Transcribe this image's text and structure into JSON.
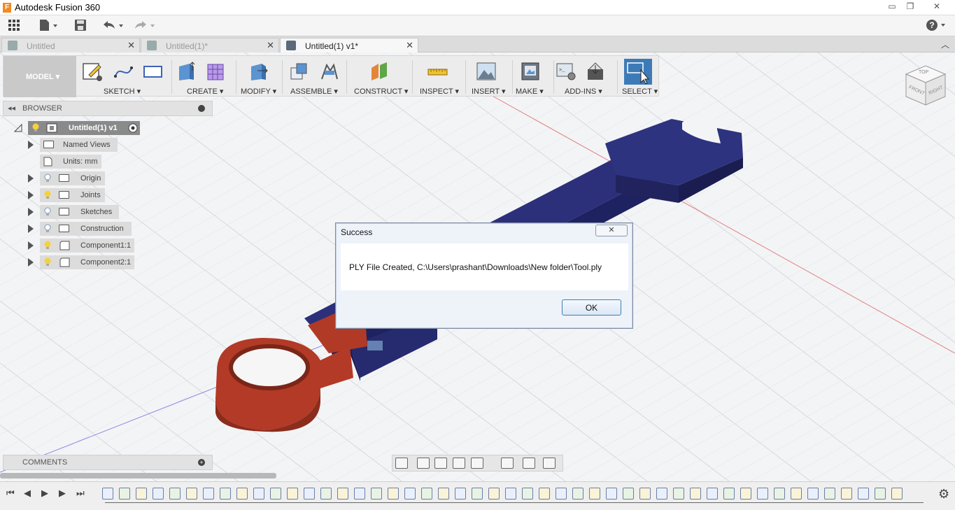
{
  "window": {
    "title": "Autodesk Fusion 360",
    "app_icon_letter": "F",
    "minimize": "▭",
    "restore": "❐",
    "close": "✕"
  },
  "tabs": [
    {
      "label": "Untitled",
      "active": false
    },
    {
      "label": "Untitled(1)*",
      "active": false
    },
    {
      "label": "Untitled(1) v1*",
      "active": true
    }
  ],
  "tab_close_glyph": "✕",
  "ribbon": {
    "workspace": "MODEL ▾",
    "groups": [
      {
        "label": "SKETCH ▾"
      },
      {
        "label": "CREATE ▾"
      },
      {
        "label": "MODIFY ▾"
      },
      {
        "label": "ASSEMBLE ▾"
      },
      {
        "label": "CONSTRUCT ▾"
      },
      {
        "label": "INSPECT ▾"
      },
      {
        "label": "INSERT ▾"
      },
      {
        "label": "MAKE ▾"
      },
      {
        "label": "ADD-INS ▾"
      },
      {
        "label": "SELECT ▾"
      }
    ]
  },
  "browser": {
    "title": "BROWSER",
    "pin": "◂◂",
    "root": "Untitled(1) v1",
    "items": [
      {
        "label": "Named Views"
      },
      {
        "label": "Units: mm"
      },
      {
        "label": "Origin"
      },
      {
        "label": "Joints"
      },
      {
        "label": "Sketches"
      },
      {
        "label": "Construction"
      },
      {
        "label": "Component1:1"
      },
      {
        "label": "Component2:1"
      }
    ]
  },
  "comments": {
    "title": "COMMENTS",
    "add": "+"
  },
  "viewcube": {
    "top": "TOP",
    "front": "FRONT",
    "right": "RIGHT"
  },
  "dialog": {
    "title": "Success",
    "close": "✕",
    "message": "PLY File Created, C:\\Users\\prashant\\Downloads\\New folder\\Tool.ply",
    "ok": "OK"
  },
  "colors": {
    "wrench_blue": "#2e3380",
    "wrench_red": "#b23a26",
    "selection_blue": "#3d7bb8"
  }
}
